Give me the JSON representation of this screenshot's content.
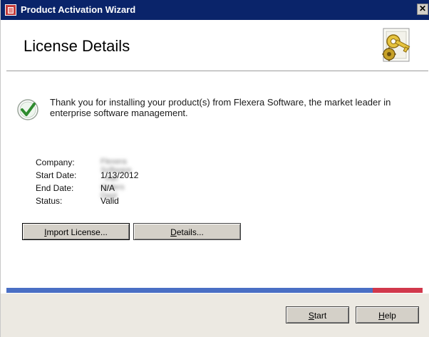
{
  "window": {
    "title": "Product Activation Wizard",
    "close_glyph": "✕"
  },
  "header": {
    "heading": "License Details",
    "icon": "key-document-icon"
  },
  "message": {
    "icon": "check-circle-icon",
    "text": "Thank you for installing your product(s) from Flexera Software, the market leader in enterprise software management."
  },
  "details": {
    "rows": [
      {
        "label": "Company:",
        "value": "Flexera Software - INK Orders Dept"
      },
      {
        "label": "Start Date:",
        "value": "1/13/2012"
      },
      {
        "label": "End Date:",
        "value": "N/A"
      },
      {
        "label": "Status:",
        "value": "Valid"
      }
    ]
  },
  "buttons": {
    "import_prefix": "I",
    "import_rest": "mport License...",
    "details_prefix": "D",
    "details_rest": "etails...",
    "start_prefix": "S",
    "start_rest": "tart",
    "help_prefix": "H",
    "help_rest": "elp"
  },
  "colors": {
    "titlebar": "#0a246a",
    "footer_line_blue": "#4a6fc4",
    "footer_line_red": "#d1384b",
    "check_green": "#2e8b2e"
  }
}
